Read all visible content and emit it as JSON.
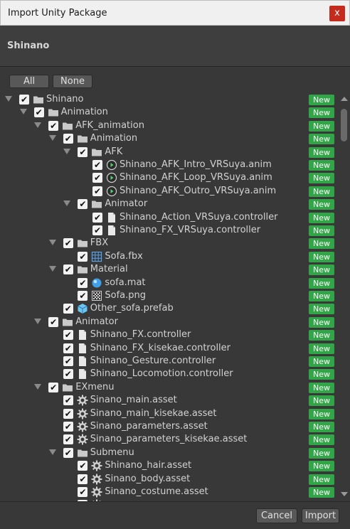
{
  "window": {
    "title": "Import Unity Package",
    "close_glyph": "x"
  },
  "header": {
    "package_name": "Shinano"
  },
  "buttons": {
    "all": "All",
    "none": "None",
    "cancel": "Cancel",
    "import": "Import"
  },
  "new_badge": "New",
  "colors": {
    "badge": "#31a547",
    "background": "#383838",
    "close": "#c42b1c"
  },
  "tree": [
    {
      "label": "Shinano",
      "depth": 0,
      "icon": "folder-icon",
      "expand": true
    },
    {
      "label": "Animation",
      "depth": 1,
      "icon": "folder-icon",
      "expand": true
    },
    {
      "label": "AFK_animation",
      "depth": 2,
      "icon": "folder-icon",
      "expand": true
    },
    {
      "label": "Animation",
      "depth": 3,
      "icon": "folder-icon",
      "expand": true
    },
    {
      "label": "AFK",
      "depth": 4,
      "icon": "folder-icon",
      "expand": true
    },
    {
      "label": "Shinano_AFK_Intro_VRSuya.anim",
      "depth": 5,
      "icon": "animation-clip-icon",
      "expand": false
    },
    {
      "label": "Shinano_AFK_Loop_VRSuya.anim",
      "depth": 5,
      "icon": "animation-clip-icon",
      "expand": false
    },
    {
      "label": "Shinano_AFK_Outro_VRSuya.anim",
      "depth": 5,
      "icon": "animation-clip-icon",
      "expand": false
    },
    {
      "label": "Animator",
      "depth": 4,
      "icon": "folder-icon",
      "expand": true
    },
    {
      "label": "Shinano_Action_VRSuya.controller",
      "depth": 5,
      "icon": "file-icon",
      "expand": false
    },
    {
      "label": "Shinano_FX_VRSuya.controller",
      "depth": 5,
      "icon": "file-icon",
      "expand": false
    },
    {
      "label": "FBX",
      "depth": 3,
      "icon": "folder-icon",
      "expand": true
    },
    {
      "label": "Sofa.fbx",
      "depth": 4,
      "icon": "mesh-grid-icon",
      "expand": false
    },
    {
      "label": "Material",
      "depth": 3,
      "icon": "folder-icon",
      "expand": true
    },
    {
      "label": "sofa.mat",
      "depth": 4,
      "icon": "material-sphere-icon",
      "expand": false
    },
    {
      "label": "Sofa.png",
      "depth": 4,
      "icon": "texture-icon",
      "expand": false
    },
    {
      "label": "Other_sofa.prefab",
      "depth": 3,
      "icon": "prefab-cube-icon",
      "expand": false
    },
    {
      "label": "Animator",
      "depth": 2,
      "icon": "folder-icon",
      "expand": true
    },
    {
      "label": "Shinano_FX.controller",
      "depth": 3,
      "icon": "file-icon",
      "expand": false
    },
    {
      "label": "Shinano_FX_kisekae.controller",
      "depth": 3,
      "icon": "file-icon",
      "expand": false
    },
    {
      "label": "Shinano_Gesture.controller",
      "depth": 3,
      "icon": "file-icon",
      "expand": false
    },
    {
      "label": "Shinano_Locomotion.controller",
      "depth": 3,
      "icon": "file-icon",
      "expand": false
    },
    {
      "label": "EXmenu",
      "depth": 2,
      "icon": "folder-icon",
      "expand": true
    },
    {
      "label": "Sinano_main.asset",
      "depth": 3,
      "icon": "gear-icon",
      "expand": false
    },
    {
      "label": "Sinano_main_kisekae.asset",
      "depth": 3,
      "icon": "gear-icon",
      "expand": false
    },
    {
      "label": "Sinano_parameters.asset",
      "depth": 3,
      "icon": "gear-icon",
      "expand": false
    },
    {
      "label": "Sinano_parameters_kisekae.asset",
      "depth": 3,
      "icon": "gear-icon",
      "expand": false
    },
    {
      "label": "Submenu",
      "depth": 3,
      "icon": "folder-icon",
      "expand": true
    },
    {
      "label": "Shinano_hair.asset",
      "depth": 4,
      "icon": "gear-icon",
      "expand": false
    },
    {
      "label": "Sinano_body.asset",
      "depth": 4,
      "icon": "gear-icon",
      "expand": false
    },
    {
      "label": "Sinano_costume.asset",
      "depth": 4,
      "icon": "gear-icon",
      "expand": false
    },
    {
      "label": "",
      "depth": 4,
      "icon": "gear-icon",
      "expand": false
    }
  ]
}
